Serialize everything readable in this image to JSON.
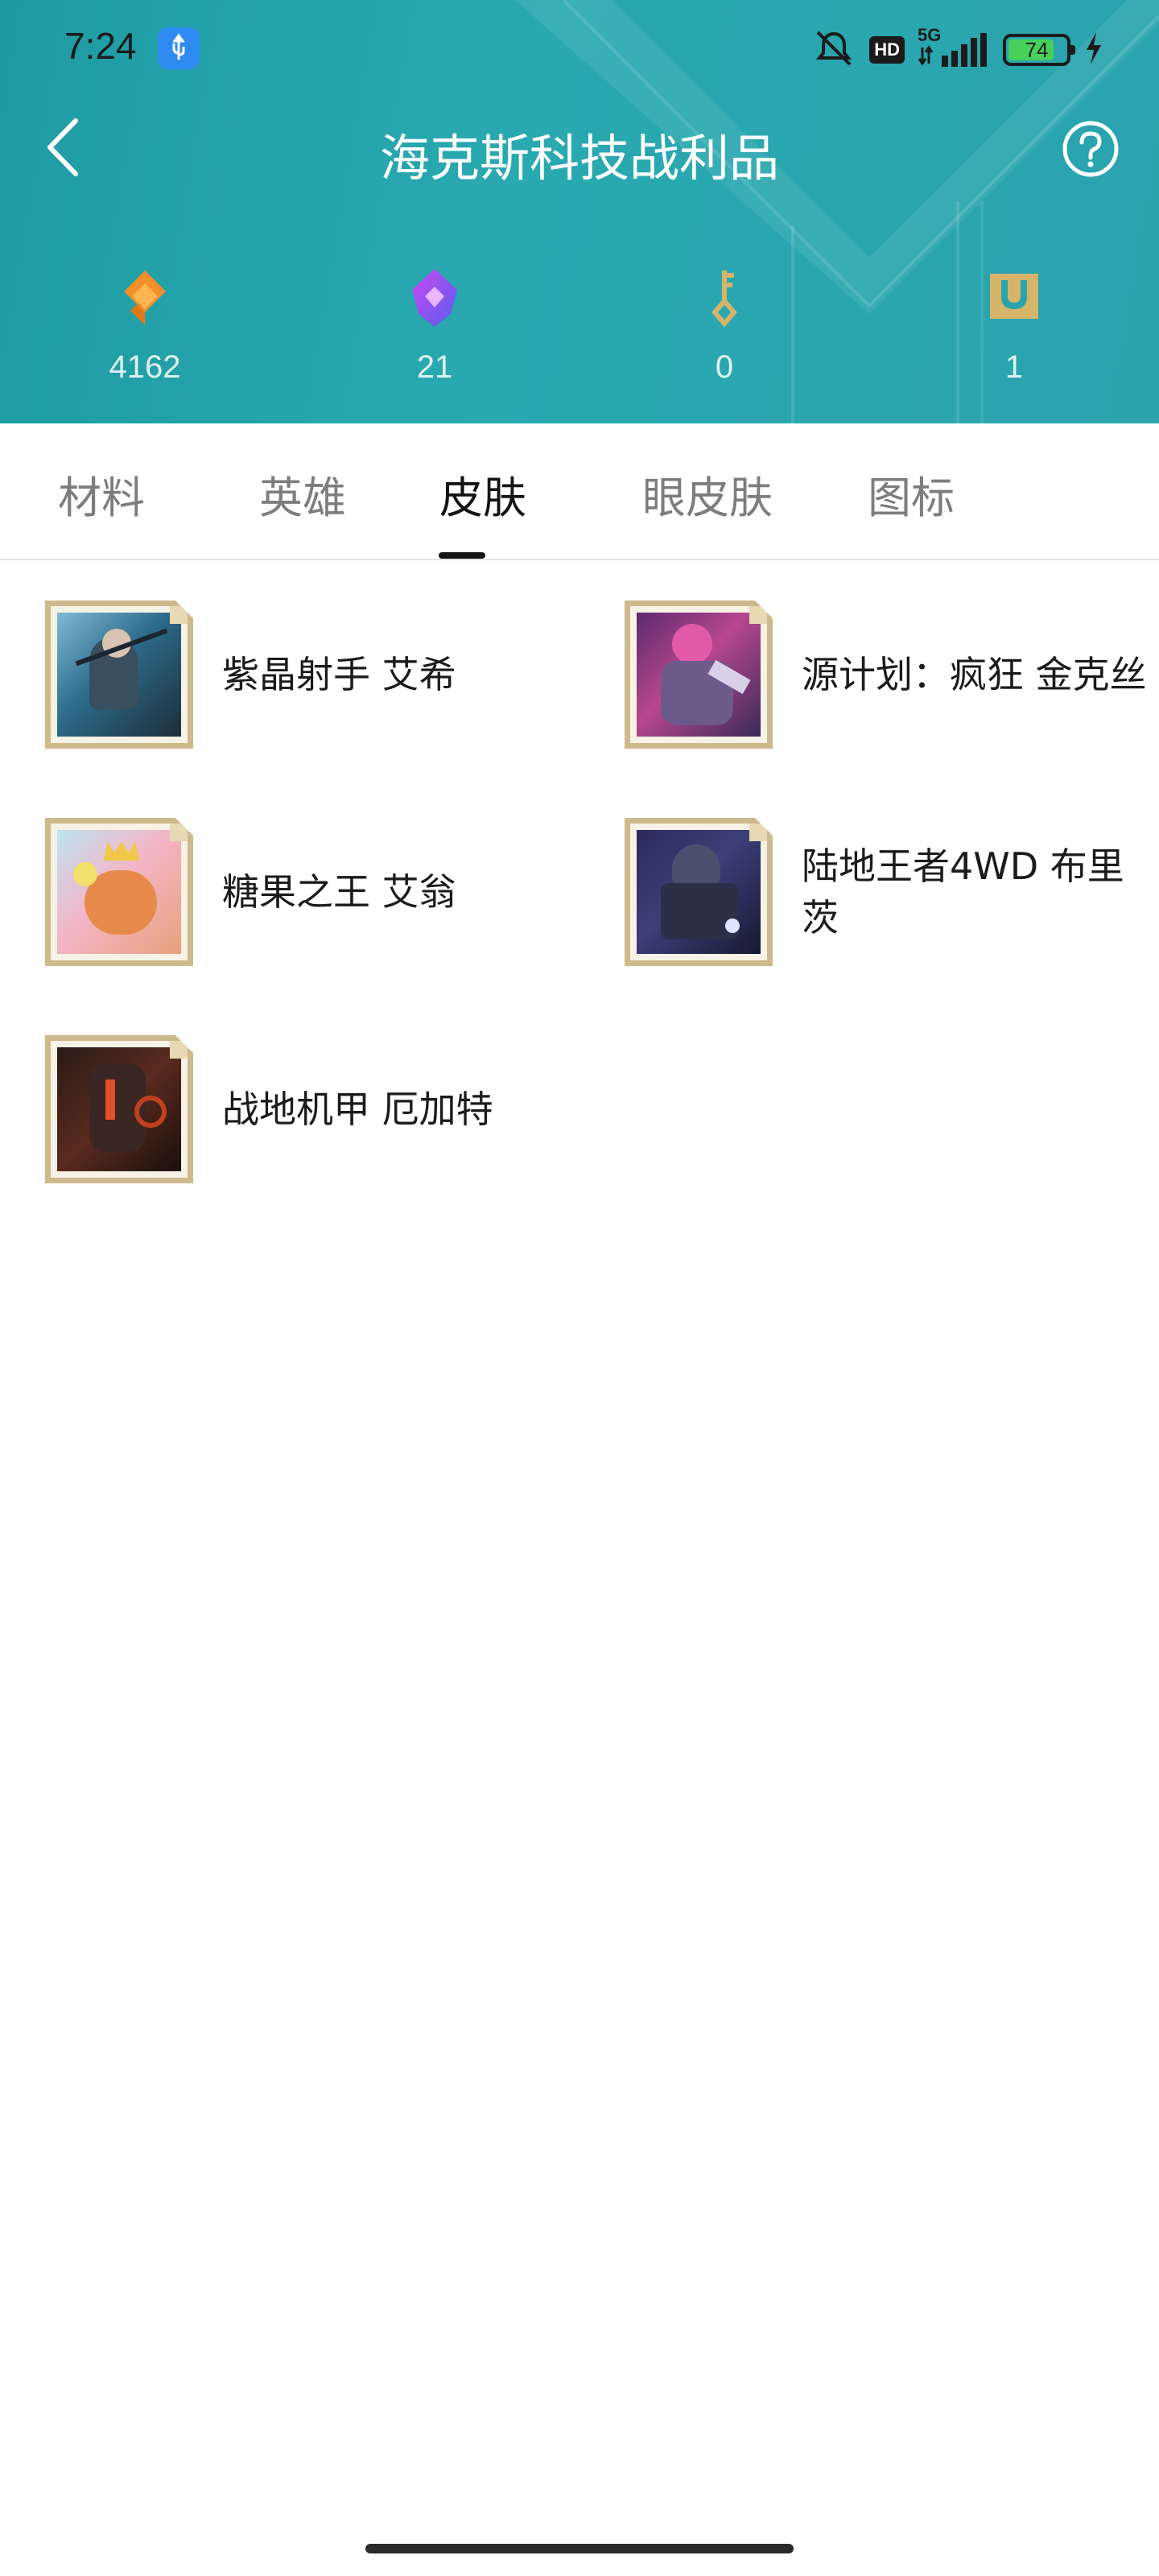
{
  "status_bar": {
    "time": "7:24",
    "network": "5G",
    "hd_badge": "HD",
    "battery_level": "74"
  },
  "header": {
    "title": "海克斯科技战利品"
  },
  "stats": [
    {
      "icon": "orange-essence-icon",
      "value": "4162"
    },
    {
      "icon": "purple-gem-icon",
      "value": "21"
    },
    {
      "icon": "key-icon",
      "value": "0"
    },
    {
      "icon": "chest-icon",
      "value": "1"
    }
  ],
  "tabs": [
    {
      "label": "材料"
    },
    {
      "label": "英雄"
    },
    {
      "label": "皮肤"
    },
    {
      "label": "眼皮肤"
    },
    {
      "label": "图标"
    }
  ],
  "active_tab": "皮肤",
  "skins": [
    {
      "name": "紫晶射手 艾希"
    },
    {
      "name": "源计划：疯狂 金克丝"
    },
    {
      "name": "糖果之王 艾翁"
    },
    {
      "name": "陆地王者4WD 布里茨"
    },
    {
      "name": "战地机甲 厄加特"
    }
  ],
  "colors": {
    "header_bg": "#25a4ac",
    "thumb_frame": "#cdb98b",
    "essence_orange": "#f0902a",
    "gem_purple": "#8a4df0",
    "key_gold": "#d6b46a"
  }
}
